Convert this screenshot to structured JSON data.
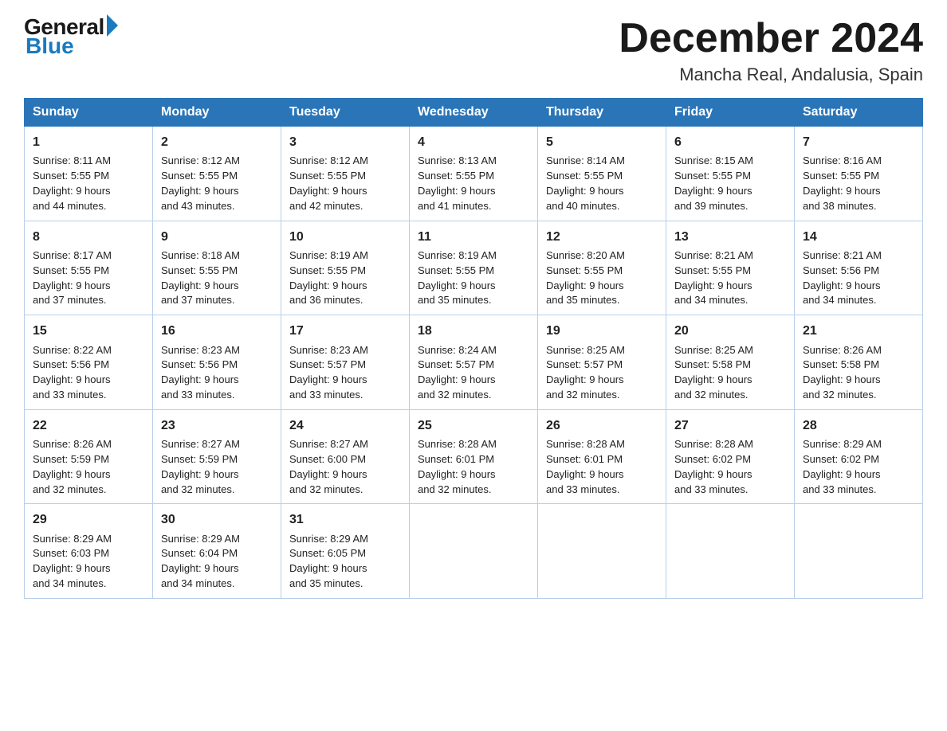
{
  "logo": {
    "general": "General",
    "blue": "Blue"
  },
  "title": "December 2024",
  "subtitle": "Mancha Real, Andalusia, Spain",
  "weekdays": [
    "Sunday",
    "Monday",
    "Tuesday",
    "Wednesday",
    "Thursday",
    "Friday",
    "Saturday"
  ],
  "weeks": [
    [
      {
        "day": "1",
        "sunrise": "8:11 AM",
        "sunset": "5:55 PM",
        "daylight": "9 hours and 44 minutes."
      },
      {
        "day": "2",
        "sunrise": "8:12 AM",
        "sunset": "5:55 PM",
        "daylight": "9 hours and 43 minutes."
      },
      {
        "day": "3",
        "sunrise": "8:12 AM",
        "sunset": "5:55 PM",
        "daylight": "9 hours and 42 minutes."
      },
      {
        "day": "4",
        "sunrise": "8:13 AM",
        "sunset": "5:55 PM",
        "daylight": "9 hours and 41 minutes."
      },
      {
        "day": "5",
        "sunrise": "8:14 AM",
        "sunset": "5:55 PM",
        "daylight": "9 hours and 40 minutes."
      },
      {
        "day": "6",
        "sunrise": "8:15 AM",
        "sunset": "5:55 PM",
        "daylight": "9 hours and 39 minutes."
      },
      {
        "day": "7",
        "sunrise": "8:16 AM",
        "sunset": "5:55 PM",
        "daylight": "9 hours and 38 minutes."
      }
    ],
    [
      {
        "day": "8",
        "sunrise": "8:17 AM",
        "sunset": "5:55 PM",
        "daylight": "9 hours and 37 minutes."
      },
      {
        "day": "9",
        "sunrise": "8:18 AM",
        "sunset": "5:55 PM",
        "daylight": "9 hours and 37 minutes."
      },
      {
        "day": "10",
        "sunrise": "8:19 AM",
        "sunset": "5:55 PM",
        "daylight": "9 hours and 36 minutes."
      },
      {
        "day": "11",
        "sunrise": "8:19 AM",
        "sunset": "5:55 PM",
        "daylight": "9 hours and 35 minutes."
      },
      {
        "day": "12",
        "sunrise": "8:20 AM",
        "sunset": "5:55 PM",
        "daylight": "9 hours and 35 minutes."
      },
      {
        "day": "13",
        "sunrise": "8:21 AM",
        "sunset": "5:55 PM",
        "daylight": "9 hours and 34 minutes."
      },
      {
        "day": "14",
        "sunrise": "8:21 AM",
        "sunset": "5:56 PM",
        "daylight": "9 hours and 34 minutes."
      }
    ],
    [
      {
        "day": "15",
        "sunrise": "8:22 AM",
        "sunset": "5:56 PM",
        "daylight": "9 hours and 33 minutes."
      },
      {
        "day": "16",
        "sunrise": "8:23 AM",
        "sunset": "5:56 PM",
        "daylight": "9 hours and 33 minutes."
      },
      {
        "day": "17",
        "sunrise": "8:23 AM",
        "sunset": "5:57 PM",
        "daylight": "9 hours and 33 minutes."
      },
      {
        "day": "18",
        "sunrise": "8:24 AM",
        "sunset": "5:57 PM",
        "daylight": "9 hours and 32 minutes."
      },
      {
        "day": "19",
        "sunrise": "8:25 AM",
        "sunset": "5:57 PM",
        "daylight": "9 hours and 32 minutes."
      },
      {
        "day": "20",
        "sunrise": "8:25 AM",
        "sunset": "5:58 PM",
        "daylight": "9 hours and 32 minutes."
      },
      {
        "day": "21",
        "sunrise": "8:26 AM",
        "sunset": "5:58 PM",
        "daylight": "9 hours and 32 minutes."
      }
    ],
    [
      {
        "day": "22",
        "sunrise": "8:26 AM",
        "sunset": "5:59 PM",
        "daylight": "9 hours and 32 minutes."
      },
      {
        "day": "23",
        "sunrise": "8:27 AM",
        "sunset": "5:59 PM",
        "daylight": "9 hours and 32 minutes."
      },
      {
        "day": "24",
        "sunrise": "8:27 AM",
        "sunset": "6:00 PM",
        "daylight": "9 hours and 32 minutes."
      },
      {
        "day": "25",
        "sunrise": "8:28 AM",
        "sunset": "6:01 PM",
        "daylight": "9 hours and 32 minutes."
      },
      {
        "day": "26",
        "sunrise": "8:28 AM",
        "sunset": "6:01 PM",
        "daylight": "9 hours and 33 minutes."
      },
      {
        "day": "27",
        "sunrise": "8:28 AM",
        "sunset": "6:02 PM",
        "daylight": "9 hours and 33 minutes."
      },
      {
        "day": "28",
        "sunrise": "8:29 AM",
        "sunset": "6:02 PM",
        "daylight": "9 hours and 33 minutes."
      }
    ],
    [
      {
        "day": "29",
        "sunrise": "8:29 AM",
        "sunset": "6:03 PM",
        "daylight": "9 hours and 34 minutes."
      },
      {
        "day": "30",
        "sunrise": "8:29 AM",
        "sunset": "6:04 PM",
        "daylight": "9 hours and 34 minutes."
      },
      {
        "day": "31",
        "sunrise": "8:29 AM",
        "sunset": "6:05 PM",
        "daylight": "9 hours and 35 minutes."
      },
      null,
      null,
      null,
      null
    ]
  ],
  "labels": {
    "sunrise": "Sunrise:",
    "sunset": "Sunset:",
    "daylight": "Daylight:"
  }
}
